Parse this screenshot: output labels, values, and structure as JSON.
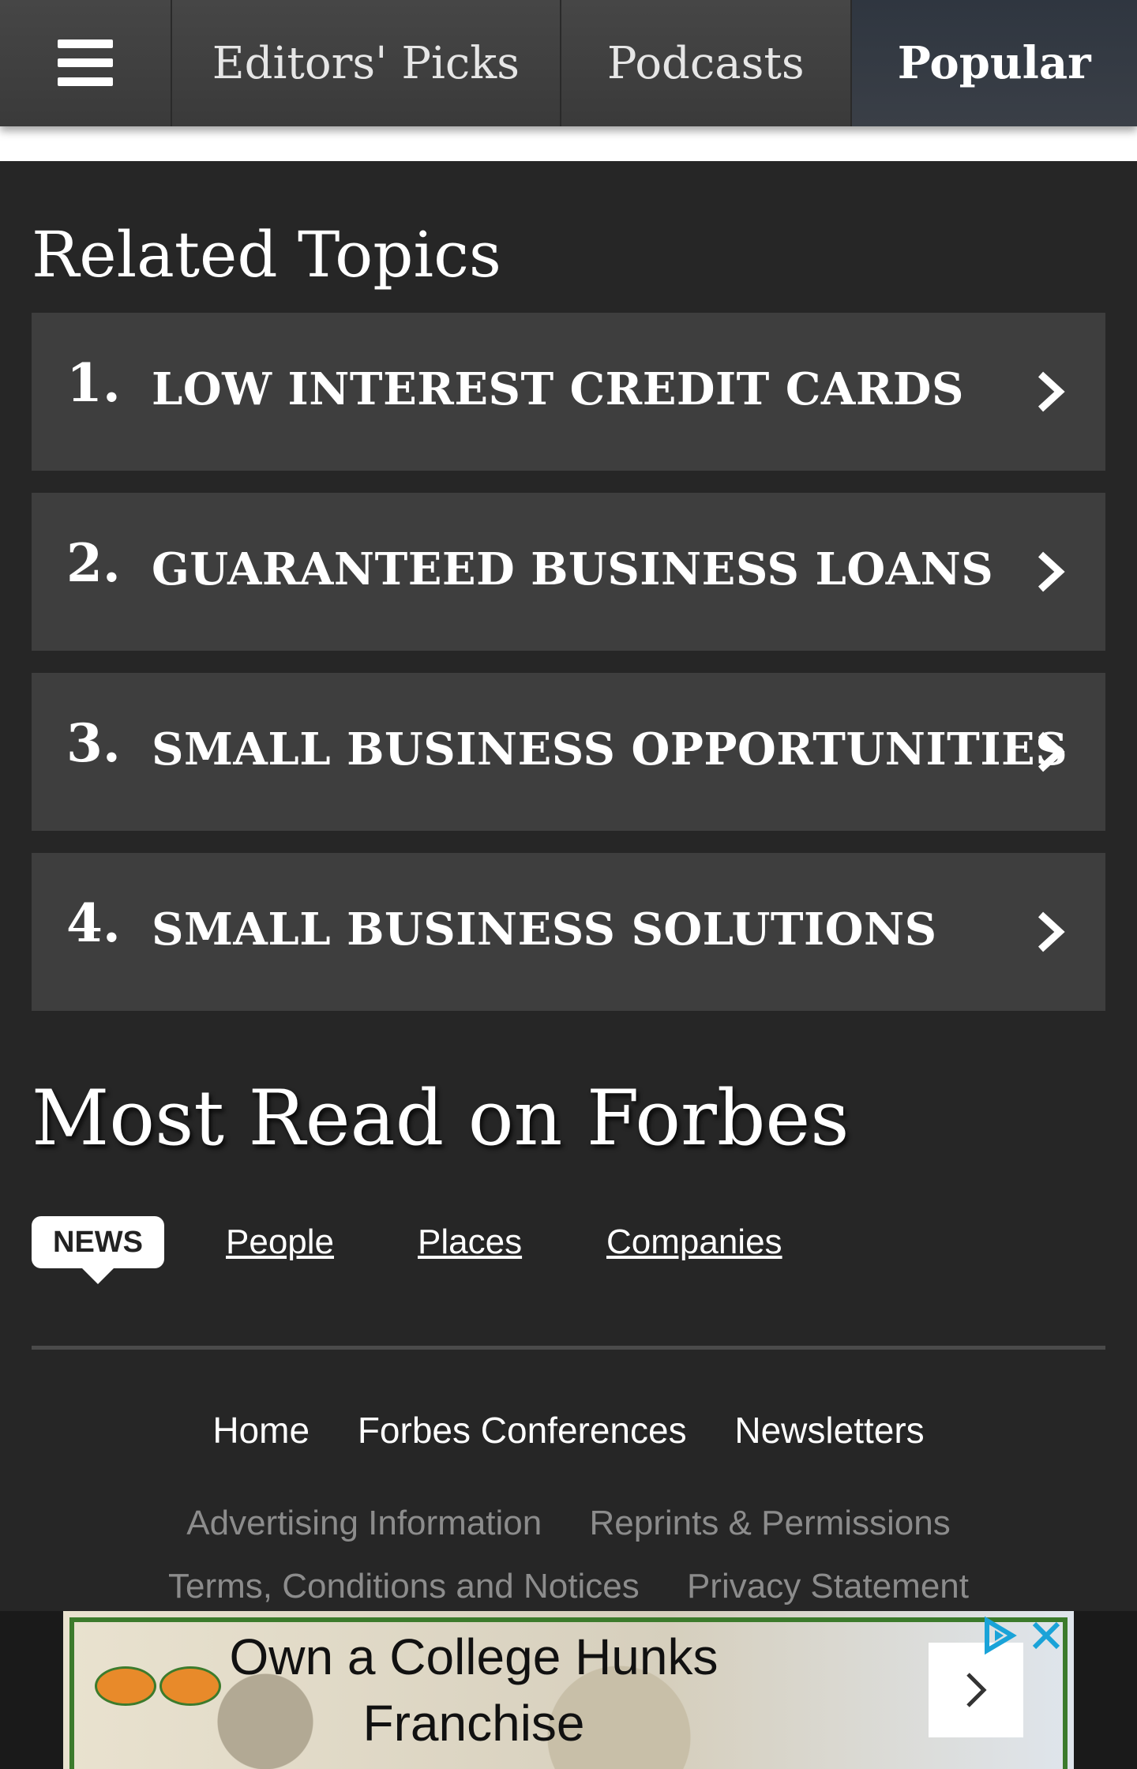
{
  "topnav": {
    "menu_icon": "hamburger-menu-icon",
    "tabs": [
      {
        "label": "Editors' Picks",
        "active": false
      },
      {
        "label": "Podcasts",
        "active": false
      },
      {
        "label": "Popular",
        "active": true
      }
    ]
  },
  "related": {
    "title": "Related Topics",
    "items": [
      {
        "num": "1.",
        "label": "LOW INTEREST CREDIT CARDS"
      },
      {
        "num": "2.",
        "label": "GUARANTEED BUSINESS LOANS"
      },
      {
        "num": "3.",
        "label": "SMALL BUSINESS OPPORTUNITIES"
      },
      {
        "num": "4.",
        "label": "SMALL BUSINESS SOLUTIONS"
      }
    ]
  },
  "most_read": {
    "title": "Most Read on Forbes",
    "tabs": [
      "NEWS",
      "People",
      "Places",
      "Companies"
    ]
  },
  "footer": {
    "primary": [
      "Home",
      "Forbes Conferences",
      "Newsletters"
    ],
    "secondary": [
      "Advertising Information",
      "Reprints & Permissions"
    ],
    "tertiary": [
      "Terms, Conditions and Notices",
      "Privacy Statement"
    ]
  },
  "ad": {
    "headline_line1": "Own a College Hunks",
    "headline_line2": "Franchise",
    "accent": "#3c7b2c"
  },
  "colors": {
    "page_bg": "#262626",
    "card_bg": "#3e3e3e",
    "ad_choices": "#1aa3d8"
  }
}
